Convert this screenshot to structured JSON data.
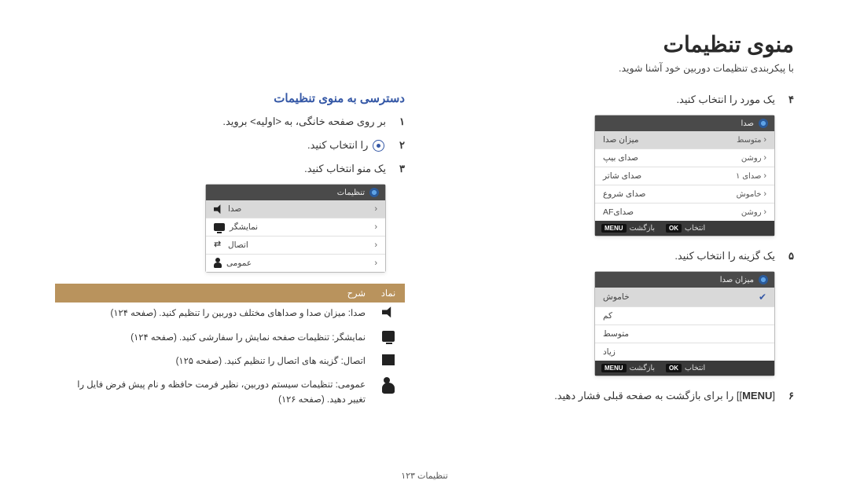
{
  "page": {
    "title": "منوی تنظیمات",
    "subtitle": "با پیکربندی تنظیمات دوربین خود آشنا شوید.",
    "footer": "تنظیمات  ۱۲۳"
  },
  "right": {
    "section_title": "دسترسی به منوی تنظیمات",
    "steps": {
      "1": {
        "num": "۱",
        "text": "بر روی صفحه خانگی، به <اولیه> بروید."
      },
      "2": {
        "num": "۲",
        "text_before": "",
        "text_after": " را انتخاب کنید."
      },
      "3": {
        "num": "۳",
        "text": "یک منو انتخاب کنید."
      }
    },
    "menu_box": {
      "header": "تنظیمات",
      "items": [
        {
          "label": "صدا",
          "selected": true
        },
        {
          "label": "نمایشگر",
          "selected": false
        },
        {
          "label": "اتصال",
          "selected": false
        },
        {
          "label": "عمومی",
          "selected": false
        }
      ]
    },
    "table": {
      "head_icon": "نماد",
      "head_desc": "شرح",
      "rows": [
        {
          "desc": "صدا: میزان صدا و صداهای مختلف دوربین را تنظیم کنید. (صفحه ۱۲۴)"
        },
        {
          "desc": "نمایشگر: تنظیمات صفحه نمایش را سفارشی کنید. (صفحه ۱۲۴)"
        },
        {
          "desc": "اتصال: گزینه های اتصال را تنظیم کنید. (صفحه ۱۲۵)"
        },
        {
          "desc": "عمومی: تنظیمات سیستم دوربین، نظیر فرمت حافظه و نام پیش فرض فایل را تغییر دهید. (صفحه ۱۲۶)"
        }
      ]
    }
  },
  "left": {
    "steps": {
      "4": {
        "num": "۴",
        "text": "یک مورد را انتخاب کنید."
      },
      "5": {
        "num": "۵",
        "text": "یک گزینه را انتخاب کنید."
      },
      "6": {
        "num": "۶",
        "text_before": "[",
        "text_key": "MENU",
        "text_after": "] را برای بازگشت به صفحه قبلی فشار دهید."
      }
    },
    "sound_box": {
      "header": "صدا",
      "items": [
        {
          "label": "میزان صدا",
          "value": "متوسط",
          "selected": true
        },
        {
          "label": "صدای بیپ",
          "value": "روشن"
        },
        {
          "label": "صدای شاتر",
          "value": "صدای ۱"
        },
        {
          "label": "صدای شروع",
          "value": "خاموش"
        },
        {
          "label": "صدایAF",
          "value": "روشن"
        }
      ],
      "footer": {
        "back": "بازگشت",
        "select": "انتخاب",
        "menu_key": "MENU",
        "ok_key": "OK"
      }
    },
    "volume_box": {
      "header": "میزان صدا",
      "items": [
        {
          "label": "خاموش",
          "checked": true
        },
        {
          "label": "کم",
          "checked": false
        },
        {
          "label": "متوسط",
          "checked": false
        },
        {
          "label": "زیاد",
          "checked": false
        }
      ],
      "footer": {
        "back": "بازگشت",
        "select": "انتخاب",
        "menu_key": "MENU",
        "ok_key": "OK"
      }
    }
  }
}
